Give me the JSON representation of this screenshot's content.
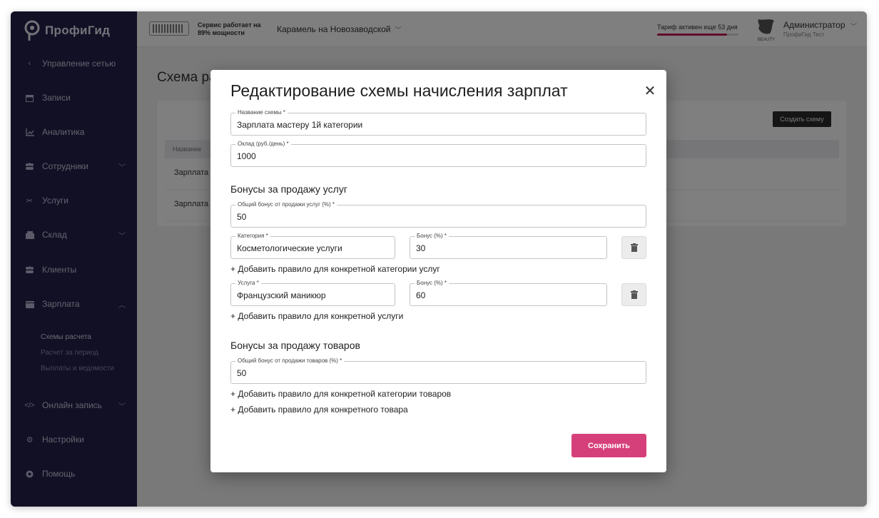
{
  "sidebar": {
    "logo": "ПрофиГид",
    "back_label": "Управление сетью",
    "items": [
      {
        "label": "Записи",
        "icon": "calendar-icon"
      },
      {
        "label": "Аналитика",
        "icon": "chart-icon"
      },
      {
        "label": "Сотрудники",
        "icon": "staff-icon"
      },
      {
        "label": "Услуги",
        "icon": "scissors-icon"
      },
      {
        "label": "Склад",
        "icon": "warehouse-icon"
      },
      {
        "label": "Клиенты",
        "icon": "clients-icon"
      },
      {
        "label": "Зарплата",
        "icon": "wallet-icon"
      },
      {
        "label": "Онлайн запись",
        "icon": "code-icon"
      },
      {
        "label": "Настройки",
        "icon": "settings-icon"
      },
      {
        "label": "Помощь",
        "icon": "help-icon"
      }
    ],
    "salary_sub": [
      "Схемы расчета",
      "Расчет за период",
      "Выплаты и ведомости"
    ]
  },
  "header": {
    "service_line1": "Сервис работает на",
    "service_line2": "89% мощности",
    "salon": "Карамель на Новозаводской",
    "tariff": "Тариф активен еще 53 дня",
    "tariff_progress": 0.86,
    "avatar_caption": "BEAUTY",
    "user_name": "Администратор",
    "user_sub": "ПрофиГид Тест"
  },
  "page": {
    "title": "Схема ра",
    "create_button": "Создать схему",
    "table_header": "Название",
    "rows": [
      "Зарплата м",
      "Зарплата м"
    ]
  },
  "modal": {
    "title": "Редактирование схемы начисления зарплат",
    "name_label": "Название схемы *",
    "name_value": "Зарплата мастеру 1й категории",
    "salary_label": "Оклад (руб./день) *",
    "salary_value": "1000",
    "services_section": "Бонусы за продажу услуг",
    "services_total_label": "Общий бонус от продажи услуг (%) *",
    "services_total_value": "50",
    "category_label": "Категория *",
    "category_value": "Косметологические услуги",
    "category_bonus_label": "Бонус (%) *",
    "category_bonus_value": "30",
    "add_category_rule": "+ Добавить правило для конкретной категории услуг",
    "service_label": "Услуга *",
    "service_value": "Французский маникюр",
    "service_bonus_label": "Бонус (%) *",
    "service_bonus_value": "60",
    "add_service_rule": "+ Добавить правило для конкретной услуги",
    "goods_section": "Бонусы за продажу товаров",
    "goods_total_label": "Общий бонус от продажи товаров (%) *",
    "goods_total_value": "50",
    "add_goods_category_rule": "+ Добавить правило для конкретной категории товаров",
    "add_goods_rule": "+ Добавить правило для конкретного товара",
    "save": "Сохранить"
  },
  "colors": {
    "sidebar": "#25204a",
    "accent": "#d6407a"
  }
}
